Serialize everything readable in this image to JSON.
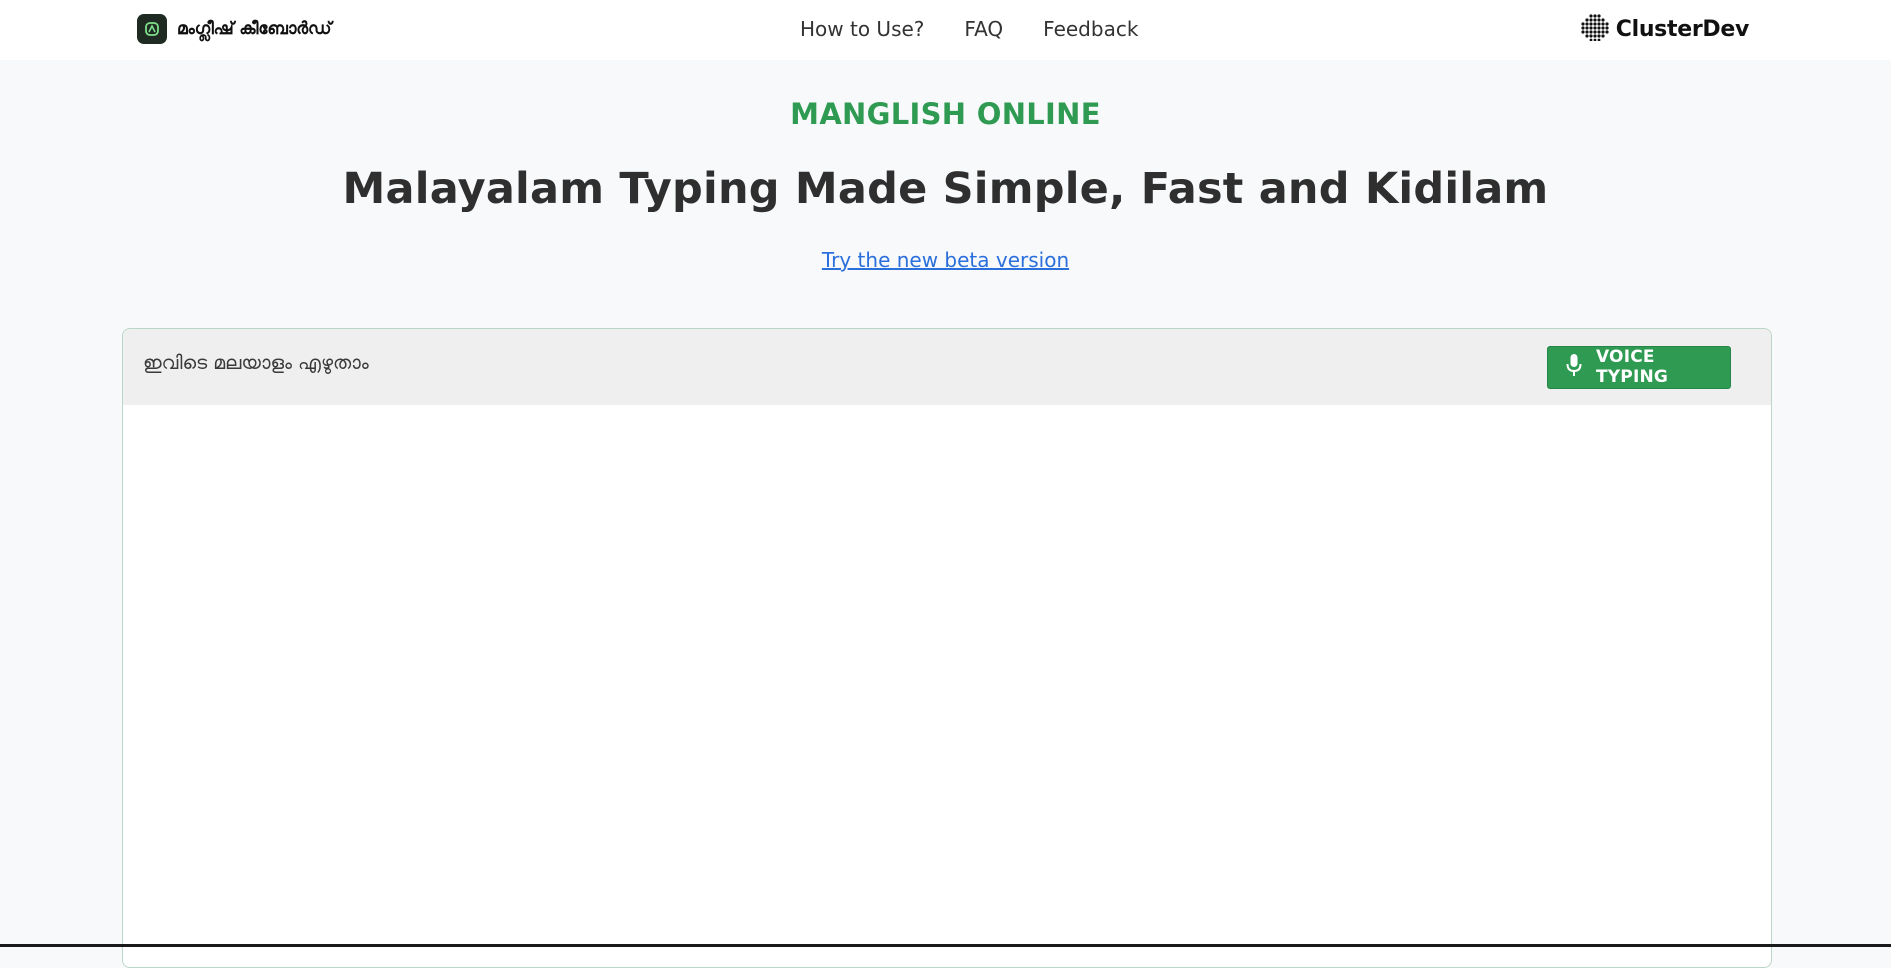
{
  "header": {
    "brand_name": "മംഗ്ലീഷ് കീബോർഡ്",
    "nav": [
      "How to Use?",
      "FAQ",
      "Feedback"
    ],
    "partner_name": "ClusterDev"
  },
  "hero": {
    "eyebrow": "MANGLISH ONLINE",
    "headline": "Malayalam Typing Made Simple, Fast and Kidilam",
    "beta_link": "Try the new beta version"
  },
  "editor": {
    "placeholder": "ഇവിടെ മലയാളം എഴുതാം",
    "voice_button": "VOICE TYPING",
    "text_value": ""
  },
  "colors": {
    "accent_green": "#2e9a52",
    "link_blue": "#2a6fdb",
    "toolbar_gray": "#efefef"
  },
  "icons": {
    "brand": "app-logo-icon",
    "partner": "clusterdev-dots-icon",
    "voice": "microphone-icon"
  }
}
